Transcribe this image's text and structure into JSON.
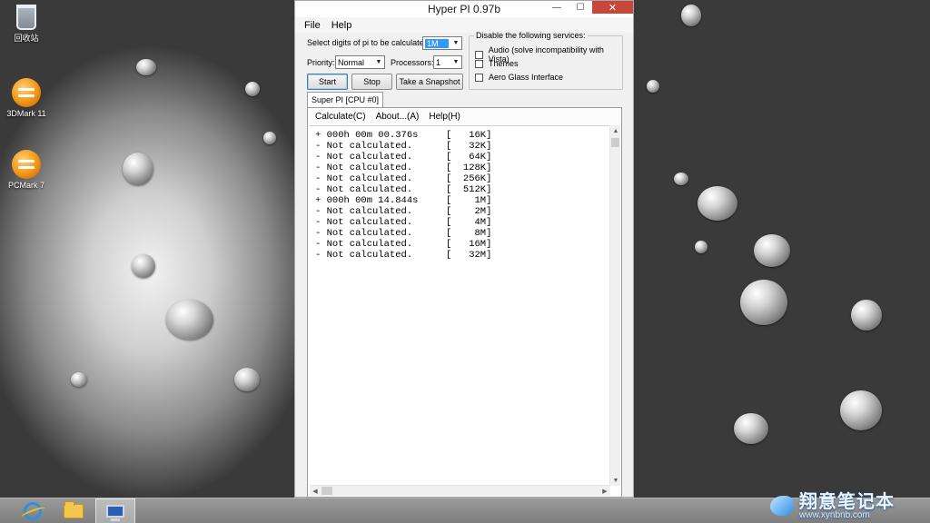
{
  "desktop": {
    "icons": [
      {
        "label": "回收站",
        "icon": "recycle-bin-icon"
      },
      {
        "label": "3DMark 11",
        "icon": "3dmark-icon"
      },
      {
        "label": "PCMark 7",
        "icon": "pcmark-icon"
      }
    ]
  },
  "window": {
    "title": "Hyper PI 0.97b",
    "controls": {
      "minimize": "—",
      "maximize": "☐",
      "close": "✕"
    },
    "menu": [
      "File",
      "Help"
    ],
    "settings": {
      "digits_label": "Select digits of pi to be calculated:",
      "digits_value": "1M",
      "priority_label": "Priority:",
      "priority_value": "Normal",
      "processors_label": "Processors:",
      "processors_value": "1"
    },
    "buttons": {
      "start": "Start",
      "stop": "Stop",
      "snapshot": "Take a Snapshot"
    },
    "services": {
      "title": "Disable the following services:",
      "items": [
        {
          "label": "Audio (solve incompatibility with Vista)",
          "checked": false
        },
        {
          "label": "Themes",
          "checked": false
        },
        {
          "label": "Aero Glass Interface",
          "checked": false
        }
      ]
    },
    "tab": "Super PI [CPU #0]",
    "inner_menu": [
      "Calculate(C)",
      "About...(A)",
      "Help(H)"
    ],
    "results": [
      {
        "status": "+ 000h 00m 00.376s",
        "size": "[   16K]"
      },
      {
        "status": "- Not calculated.",
        "size": "[   32K]"
      },
      {
        "status": "- Not calculated.",
        "size": "[   64K]"
      },
      {
        "status": "- Not calculated.",
        "size": "[  128K]"
      },
      {
        "status": "- Not calculated.",
        "size": "[  256K]"
      },
      {
        "status": "- Not calculated.",
        "size": "[  512K]"
      },
      {
        "status": "+ 000h 00m 14.844s",
        "size": "[    1M]"
      },
      {
        "status": "- Not calculated.",
        "size": "[    2M]"
      },
      {
        "status": "- Not calculated.",
        "size": "[    4M]"
      },
      {
        "status": "- Not calculated.",
        "size": "[    8M]"
      },
      {
        "status": "- Not calculated.",
        "size": "[   16M]"
      },
      {
        "status": "- Not calculated.",
        "size": "[   32M]"
      }
    ]
  },
  "taskbar": {
    "items": [
      "internet-explorer-icon",
      "file-explorer-icon",
      "computer-icon"
    ],
    "active": "computer-icon"
  },
  "watermark": {
    "main": "翔意笔记本",
    "sub": "www.xynbnb.com"
  },
  "colors": {
    "selection": "#3399ff",
    "close_button": "#c7473b",
    "taskbar": "#8a8a8a"
  }
}
